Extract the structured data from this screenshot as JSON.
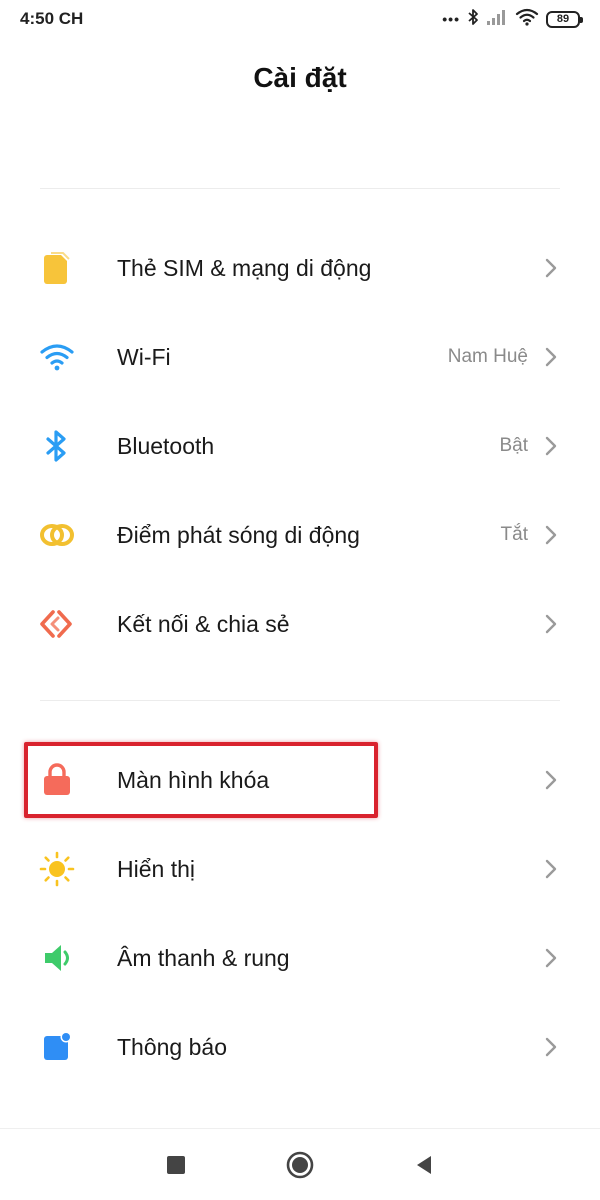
{
  "status_bar": {
    "time": "4:50 CH",
    "battery": "89",
    "icons": [
      "more-dots-icon",
      "bluetooth-icon",
      "signal-icon",
      "wifi-icon",
      "battery-icon"
    ]
  },
  "header": {
    "title": "Cài đặt"
  },
  "groups": [
    {
      "items": [
        {
          "label": "Thẻ SIM & mạng di động",
          "value": "",
          "icon": "sim-card-icon",
          "color": "#f7c43a"
        },
        {
          "label": "Wi-Fi",
          "value": "Nam Huệ",
          "icon": "wifi-icon",
          "color": "#2a9df4"
        },
        {
          "label": "Bluetooth",
          "value": "Bật",
          "icon": "bluetooth-icon",
          "color": "#2a9df4"
        },
        {
          "label": "Điểm phát sóng di động",
          "value": "Tắt",
          "icon": "hotspot-icon",
          "color": "#f2c030"
        },
        {
          "label": "Kết nối & chia sẻ",
          "value": "",
          "icon": "connection-share-icon",
          "color": "#f06b4e"
        }
      ]
    },
    {
      "items": [
        {
          "label": "Màn hình khóa",
          "value": "",
          "icon": "lock-icon",
          "color": "#f56b5b",
          "highlighted": true
        },
        {
          "label": "Hiển thị",
          "value": "",
          "icon": "sun-icon",
          "color": "#f9c31f"
        },
        {
          "label": "Âm thanh & rung",
          "value": "",
          "icon": "speaker-icon",
          "color": "#3ecb6a"
        },
        {
          "label": "Thông báo",
          "value": "",
          "icon": "notification-icon",
          "color": "#2f8ef5"
        }
      ]
    }
  ],
  "colors": {
    "highlight": "#d9232e",
    "chevron": "#9a9a9a",
    "secondary_text": "#8a8a8a"
  },
  "nav_bar": {
    "icons": [
      "recent-apps-icon",
      "home-icon",
      "back-icon"
    ]
  }
}
